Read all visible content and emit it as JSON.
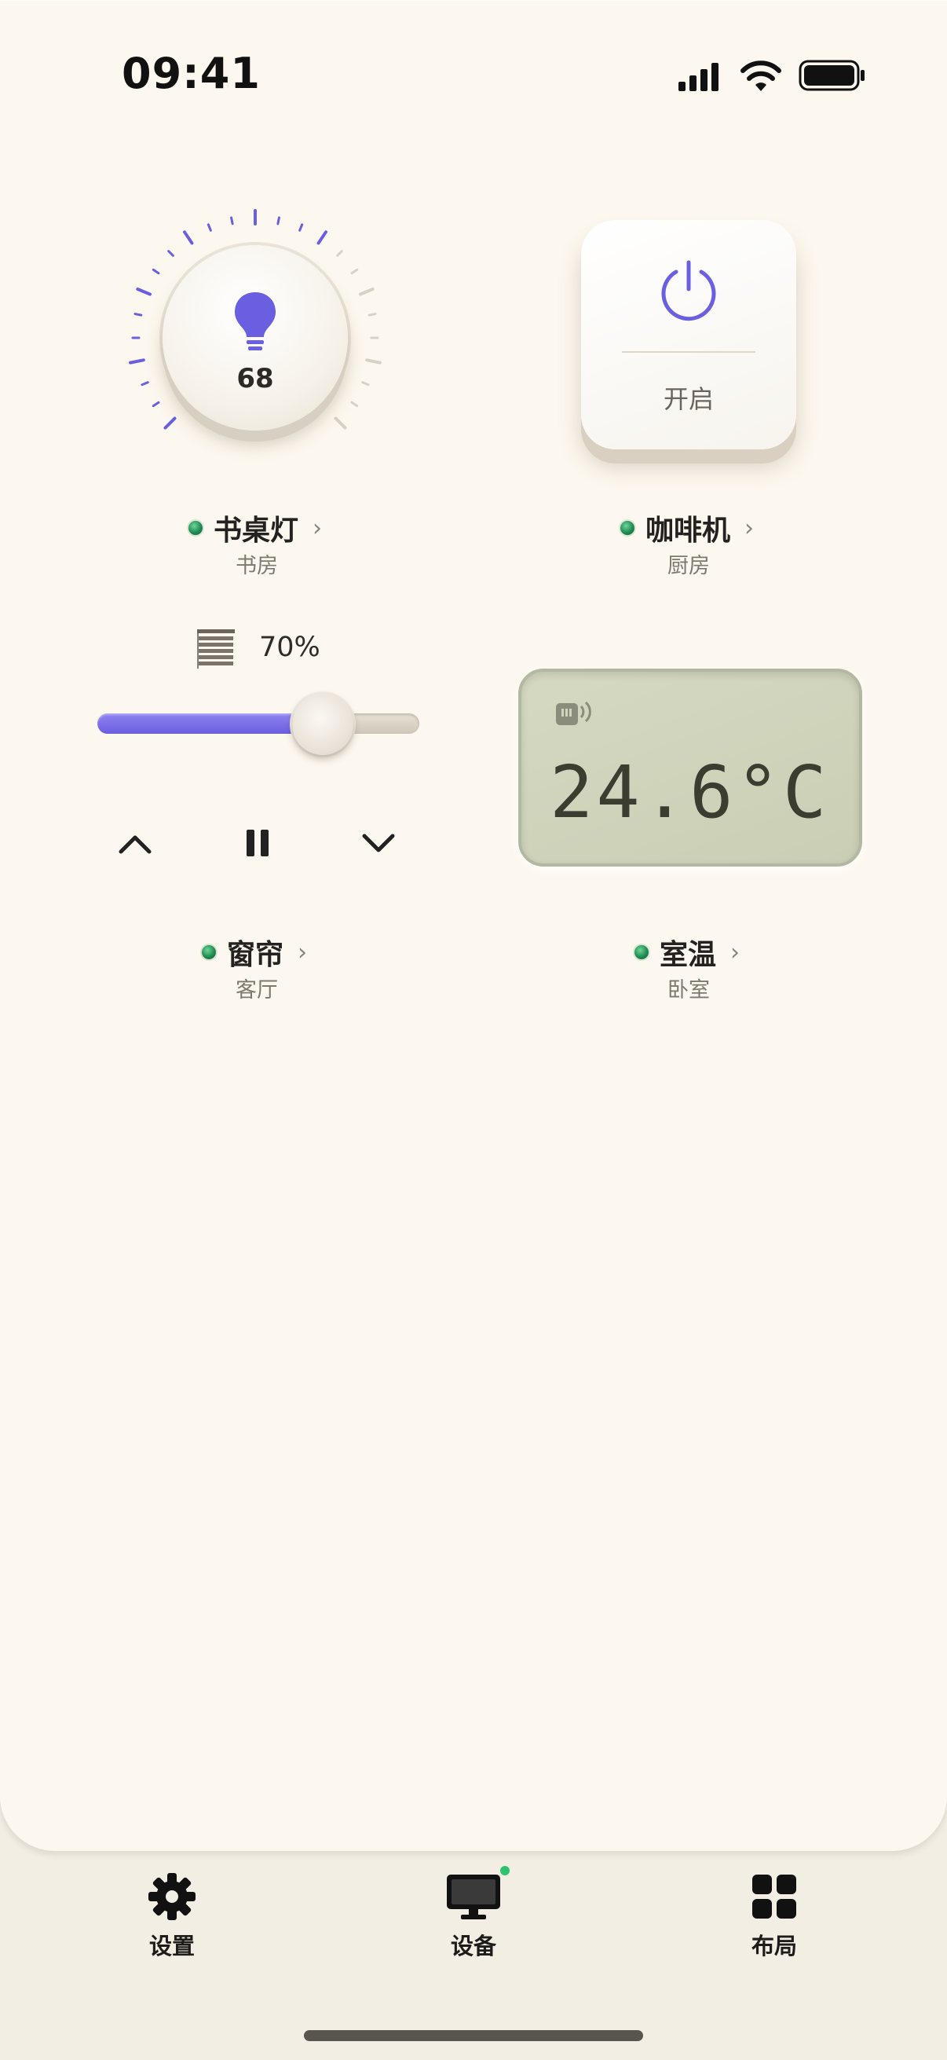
{
  "status_bar": {
    "time": "09:41"
  },
  "devices": {
    "desk_lamp": {
      "name": "书桌灯",
      "room": "书房",
      "brightness": "68"
    },
    "coffee_machine": {
      "name": "咖啡机",
      "room": "厨房",
      "button_label": "开启"
    },
    "curtain": {
      "name": "窗帘",
      "room": "客厅",
      "position": "70%",
      "position_fraction": 0.7
    },
    "room_temp": {
      "name": "室温",
      "room": "卧室",
      "temperature": "24.6°C"
    }
  },
  "tab_bar": {
    "tabs": [
      {
        "label": "设置",
        "icon": "gear-icon"
      },
      {
        "label": "设备",
        "icon": "monitor-icon",
        "active": true,
        "badge": true
      },
      {
        "label": "布局",
        "icon": "grid-icon"
      }
    ]
  },
  "colors": {
    "accent": "#6a5fe0",
    "status_green": "#1f8a52",
    "background": "#fdf8ef",
    "lcd": "#d0d4bb"
  }
}
